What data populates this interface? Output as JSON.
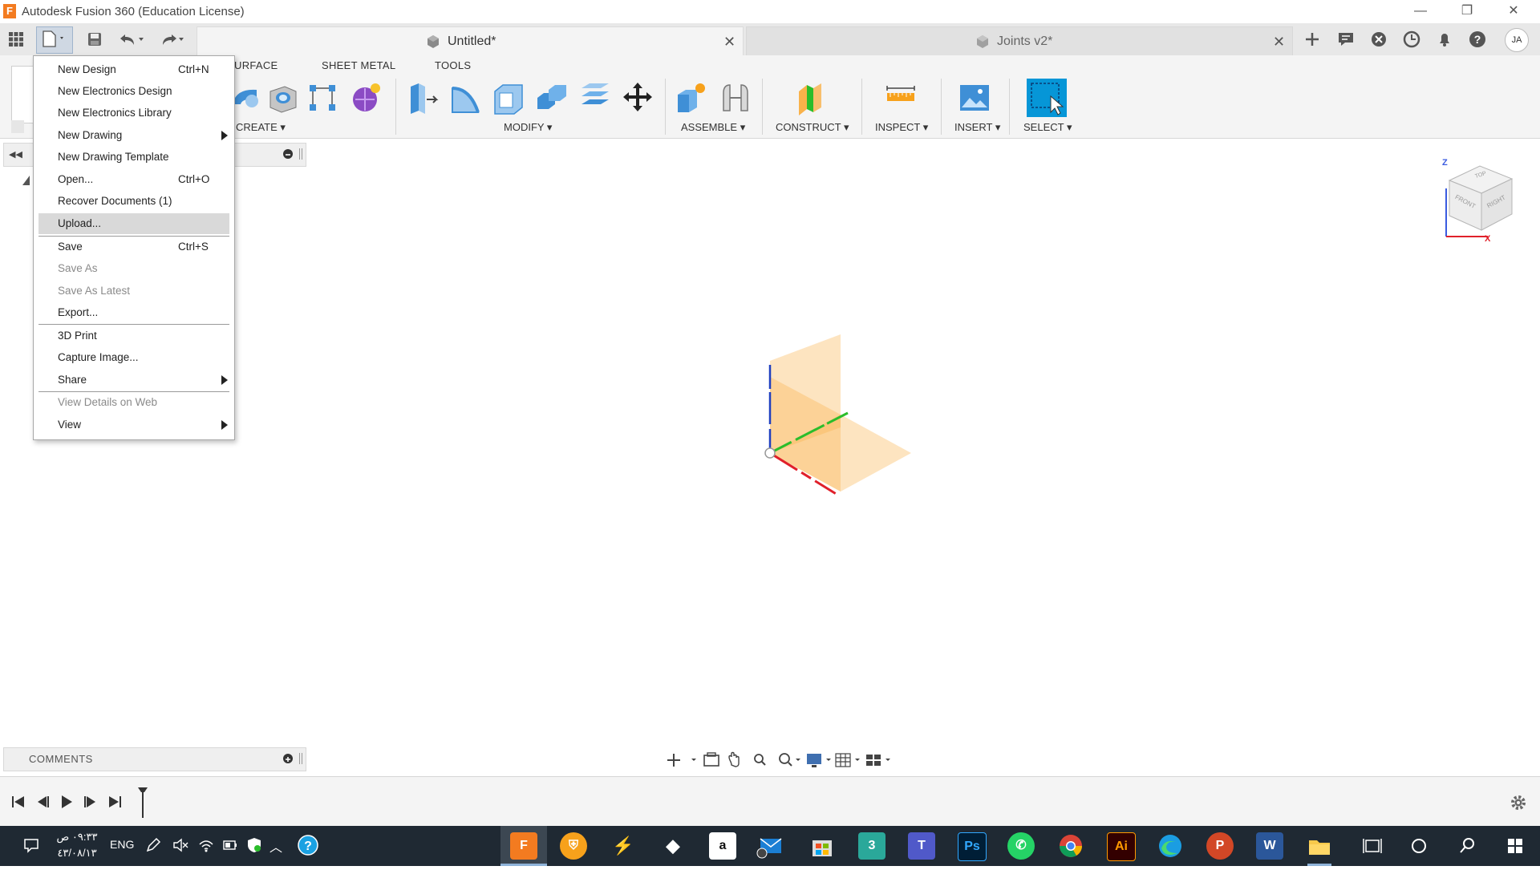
{
  "window": {
    "title": "Autodesk Fusion 360 (Education License)",
    "app_icon_letter": "F",
    "controls": {
      "minimize": "—",
      "restore": "❐",
      "close": "✕"
    }
  },
  "tabs": [
    {
      "title": "Untitled*",
      "close": "✕"
    },
    {
      "title": "Joints v2*",
      "close": "✕"
    }
  ],
  "toolbar_right_icons": [
    "add-icon",
    "comments-icon",
    "extensions-icon",
    "job-status-icon",
    "notifications-icon",
    "help-icon"
  ],
  "user": {
    "initials": "JA"
  },
  "ribbon": {
    "tabs": [
      "URFACE",
      "SHEET METAL",
      "TOOLS"
    ],
    "groups": [
      "CREATE ▾",
      "MODIFY ▾",
      "ASSEMBLE ▾",
      "CONSTRUCT ▾",
      "INSPECT ▾",
      "INSERT ▾",
      "SELECT ▾"
    ]
  },
  "file_menu": {
    "items": [
      {
        "label": "New Design",
        "shortcut": "Ctrl+N"
      },
      {
        "label": "New Electronics Design",
        "shortcut": ""
      },
      {
        "label": "New Electronics Library",
        "shortcut": ""
      },
      {
        "label": "New Drawing",
        "shortcut": "",
        "submenu": true
      },
      {
        "label": "New Drawing Template",
        "shortcut": ""
      },
      {
        "label": "Open...",
        "shortcut": "Ctrl+O"
      },
      {
        "label": "Recover Documents (1)",
        "shortcut": ""
      },
      {
        "label": "Upload...",
        "shortcut": "",
        "highlighted": true
      },
      {
        "label": "Save",
        "shortcut": "Ctrl+S"
      },
      {
        "label": "Save As",
        "shortcut": "",
        "disabled": true
      },
      {
        "label": "Save As Latest",
        "shortcut": "",
        "disabled": true
      },
      {
        "label": "Export...",
        "shortcut": ""
      },
      {
        "label": "3D Print",
        "shortcut": ""
      },
      {
        "label": "Capture Image...",
        "shortcut": ""
      },
      {
        "label": "Share",
        "shortcut": "",
        "submenu": true
      },
      {
        "label": "View Details on Web",
        "shortcut": "",
        "disabled": true
      },
      {
        "label": "View",
        "shortcut": "",
        "submenu": true
      }
    ]
  },
  "panels": {
    "comments_label": "COMMENTS"
  },
  "viewcube": {
    "top": "TOP",
    "front": "FRONT",
    "right": "RIGHT",
    "axis_z": "Z",
    "axis_x": "X"
  },
  "taskbar": {
    "time": "٠٩:٣٣ ص",
    "date": "٤٣/٠٨/١٣",
    "language": "ENG",
    "apps": [
      "fusion-360",
      "bitwarden",
      "hammer",
      "dropbox",
      "amazon",
      "mail",
      "store",
      "3ds-max",
      "teams",
      "photoshop",
      "whatsapp",
      "chrome",
      "illustrator",
      "edge",
      "powerpoint",
      "word",
      "file-explorer"
    ]
  },
  "colors": {
    "accent_blue": "#0696d7",
    "plane_orange": "#f9b24a",
    "axis_x": "#e0202a",
    "axis_y": "#2bbd2b",
    "axis_z": "#1f3fbf",
    "taskbar": "#1f2933"
  }
}
